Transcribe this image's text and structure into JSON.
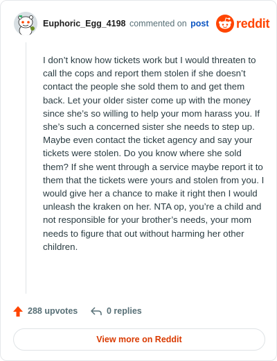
{
  "comment": {
    "username": "Euphoric_Egg_4198",
    "action_text": "commented on",
    "post_link": "post",
    "body": "I don’t know how tickets work but I would threaten to call the cops and report them stolen if she doesn’t contact the people she sold them to and get them back. Let your older sister come up with the money since she’s so willing to help your mom harass you. If she’s such a concerned sister she needs to step up. Maybe even contact the ticket agency and say your tickets were stolen. Do you know where she sold them? If she went through a service maybe report it to them that the tickets were yours and stolen from you. I would give her a chance to make it right then I would unleash the kraken on her. NTA op, you’re a child and not responsible for your brother’s needs, your mom needs to figure that out without harming her other children.",
    "upvotes": "288 upvotes",
    "replies": "0 replies"
  },
  "brand": {
    "name": "reddit",
    "color": "#ff4500"
  },
  "footer": {
    "view_more_label": "View more on Reddit"
  },
  "icons": {
    "upvote": "upvote-arrow-icon",
    "reply": "reply-arrow-icon",
    "logo": "reddit-logo-icon",
    "avatar": "snoo-avatar"
  }
}
